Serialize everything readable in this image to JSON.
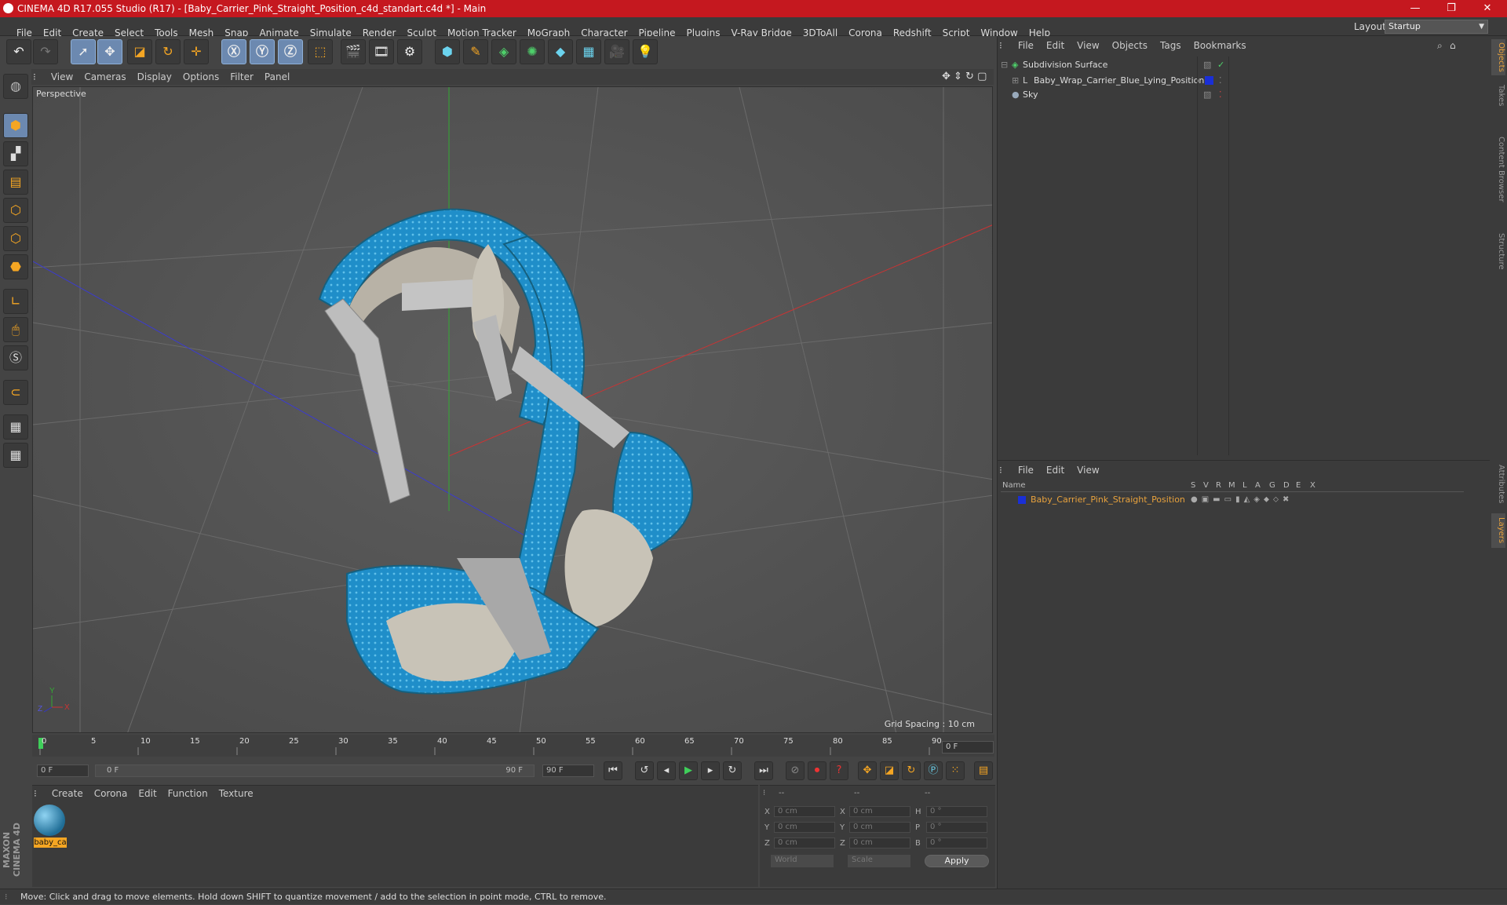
{
  "titlebar": {
    "title": "CINEMA 4D R17.055 Studio (R17) - [Baby_Carrier_Pink_Straight_Position_c4d_standart.c4d *] - Main",
    "minimize": "—",
    "restore": "❐",
    "close": "✕"
  },
  "menu": [
    "File",
    "Edit",
    "Create",
    "Select",
    "Tools",
    "Mesh",
    "Snap",
    "Animate",
    "Simulate",
    "Render",
    "Sculpt",
    "Motion Tracker",
    "MoGraph",
    "Character",
    "Pipeline",
    "Plugins",
    "V-Ray Bridge",
    "3DToAll",
    "Corona",
    "Redshift",
    "Script",
    "Window",
    "Help"
  ],
  "layout": {
    "label": "Layout:",
    "value": "Startup"
  },
  "viewport": {
    "menu": [
      "View",
      "Cameras",
      "Display",
      "Options",
      "Filter",
      "Panel"
    ],
    "label": "Perspective",
    "grid_spacing": "Grid Spacing : 10 cm"
  },
  "timeline": {
    "ticks": [
      "0",
      "5",
      "10",
      "15",
      "20",
      "25",
      "30",
      "35",
      "40",
      "45",
      "50",
      "55",
      "60",
      "65",
      "70",
      "75",
      "80",
      "85",
      "90"
    ],
    "end_field": "0 F"
  },
  "transport": {
    "start": "0 F",
    "range_start": "0 F",
    "range_end": "90 F",
    "end": "90 F"
  },
  "material_manager": {
    "menu": [
      "Create",
      "Corona",
      "Edit",
      "Function",
      "Texture"
    ],
    "material_name": "baby_ca"
  },
  "coordinates": {
    "header": [
      "--",
      "--",
      "--"
    ],
    "rows": [
      {
        "a": "X",
        "av": "0 cm",
        "b": "X",
        "bv": "0 cm",
        "c": "H",
        "cv": "0 °"
      },
      {
        "a": "Y",
        "av": "0 cm",
        "b": "Y",
        "bv": "0 cm",
        "c": "P",
        "cv": "0 °"
      },
      {
        "a": "Z",
        "av": "0 cm",
        "b": "Z",
        "bv": "0 cm",
        "c": "B",
        "cv": "0 °"
      }
    ],
    "mode1": "World",
    "mode2": "Scale",
    "apply": "Apply"
  },
  "object_manager": {
    "menu": [
      "File",
      "Edit",
      "View",
      "Objects",
      "Tags",
      "Bookmarks"
    ],
    "objects": [
      {
        "name": "Subdivision Surface",
        "color": "#2a2a2a"
      },
      {
        "name": "Baby_Wrap_Carrier_Blue_Lying_Position",
        "color": "#1a2fd6"
      },
      {
        "name": "Sky",
        "color": "#2a2a2a"
      }
    ]
  },
  "layer_manager": {
    "menu": [
      "File",
      "Edit",
      "View"
    ],
    "columns": [
      "Name",
      "S",
      "V",
      "R",
      "M",
      "L",
      "A",
      "G",
      "D",
      "E",
      "X"
    ],
    "layer_name": "Baby_Carrier_Pink_Straight_Position"
  },
  "right_tabs": [
    "Objects",
    "Takes",
    "Content Browser",
    "Structure",
    "Attributes",
    "Layers"
  ],
  "status": "Move: Click and drag to move elements. Hold down SHIFT to quantize movement / add to the selection in point mode, CTRL to remove.",
  "brand": "MAXON CINEMA 4D",
  "colors": {
    "title": "#c5181f",
    "accent": "#f5a623",
    "selection": "#6c89b0",
    "layer_text": "#e8a23d",
    "carrier_blue": "#1f8ec9"
  }
}
